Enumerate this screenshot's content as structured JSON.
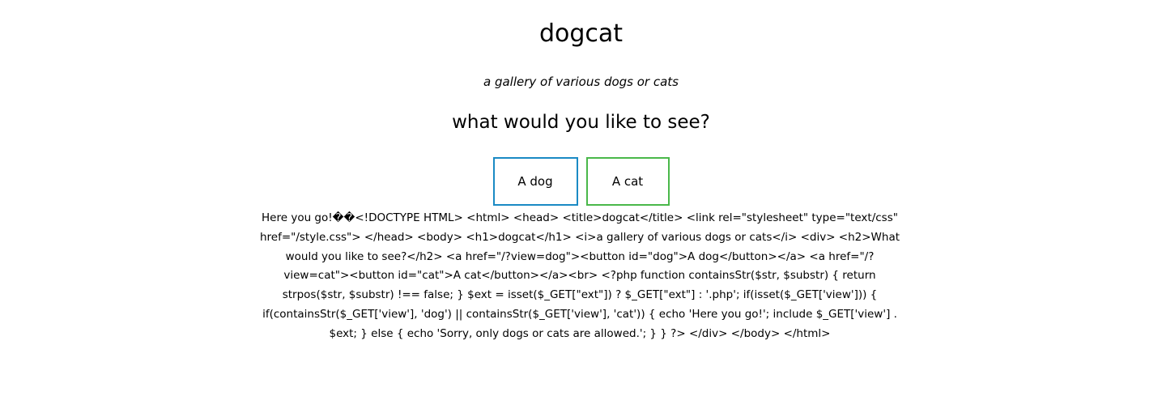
{
  "header": {
    "title": "dogcat",
    "subtitle": "a gallery of various dogs or cats",
    "question": "what would you like to see?"
  },
  "buttons": {
    "dog_label": "A dog",
    "dog_color": "#1a8ac4",
    "cat_label": "A cat",
    "cat_color": "#4ab84a"
  },
  "output": {
    "text": "Here you go!��<!DOCTYPE HTML> <html> <head> <title>dogcat</title> <link rel=\"stylesheet\" type=\"text/css\" href=\"/style.css\"> </head> <body> <h1>dogcat</h1> <i>a gallery of various dogs or cats</i> <div> <h2>What would you like to see?</h2> <a href=\"/?view=dog\"><button id=\"dog\">A dog</button></a> <a href=\"/?view=cat\"><button id=\"cat\">A cat</button></a><br> <?php function containsStr($str, $substr) { return strpos($str, $substr) !== false; } $ext = isset($_GET[\"ext\"]) ? $_GET[\"ext\"] : '.php'; if(isset($_GET['view'])) { if(containsStr($_GET['view'], 'dog') || containsStr($_GET['view'], 'cat')) { echo 'Here you go!'; include $_GET['view'] . $ext; } else { echo 'Sorry, only dogs or cats are allowed.'; } } ?> </div> </body> </html>"
  }
}
